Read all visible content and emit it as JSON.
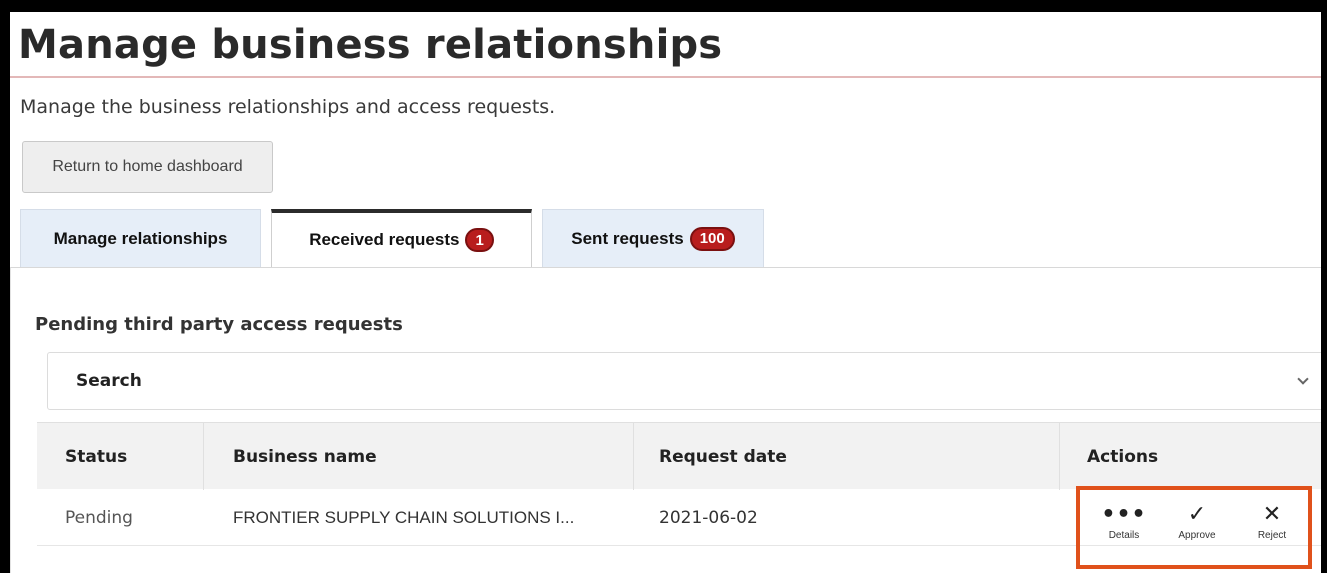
{
  "page": {
    "title": "Manage business relationships",
    "subtitle": "Manage the business relationships and access requests.",
    "home_button": "Return to home dashboard"
  },
  "tabs": [
    {
      "label": "Manage relationships",
      "badge": ""
    },
    {
      "label": "Received requests",
      "badge": "1"
    },
    {
      "label": "Sent requests",
      "badge": "100"
    }
  ],
  "active_tab": "Received requests",
  "section": {
    "label": "Pending third party access requests",
    "search_label": "Search"
  },
  "table": {
    "columns": [
      "Status",
      "Business name",
      "Request date",
      "Actions"
    ],
    "rows": [
      {
        "status": "Pending",
        "business_name": "FRONTIER SUPPLY CHAIN SOLUTIONS I...",
        "request_date": "2021-06-02"
      }
    ]
  },
  "actions": [
    {
      "label": "Details",
      "icon": "more-icon"
    },
    {
      "label": "Approve",
      "icon": "check-icon"
    },
    {
      "label": "Reject",
      "icon": "close-icon"
    }
  ],
  "colors": {
    "badge": "#b81d1d",
    "highlight": "#e0511b",
    "tab_inactive": "#e6eef8"
  }
}
